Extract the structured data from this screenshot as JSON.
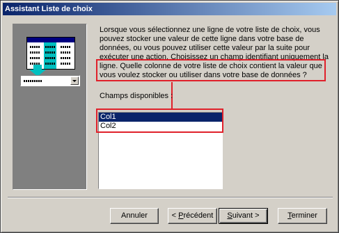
{
  "window": {
    "title": "Assistant Liste de choix"
  },
  "description": {
    "part1": "Lorsque vous sélectionnez une ligne de votre liste de choix, vous pouvez stocker une valeur de cette ligne dans votre base de données, ou vous pouvez utiliser cette valeur par la suite pour exécuter une action. Choisissez un champ identifiant uniquement la ligne. ",
    "part2": "Quelle colonne de votre liste de choix contient la valeur que vous voulez stocker ou utiliser dans votre base de données ?"
  },
  "fields": {
    "label": "Champs disponibles :",
    "items": [
      "Col1",
      "Col2"
    ],
    "selected_index": 0
  },
  "buttons": {
    "cancel": "Annuler",
    "back": {
      "pre": "< ",
      "key": "P",
      "post": "récédent"
    },
    "next": {
      "key": "S",
      "post": "uivant >"
    },
    "finish": {
      "key": "T",
      "post": "erminer"
    }
  },
  "colors": {
    "highlight": "#e0202a",
    "title_start": "#0a246a",
    "title_end": "#a6caf0"
  }
}
